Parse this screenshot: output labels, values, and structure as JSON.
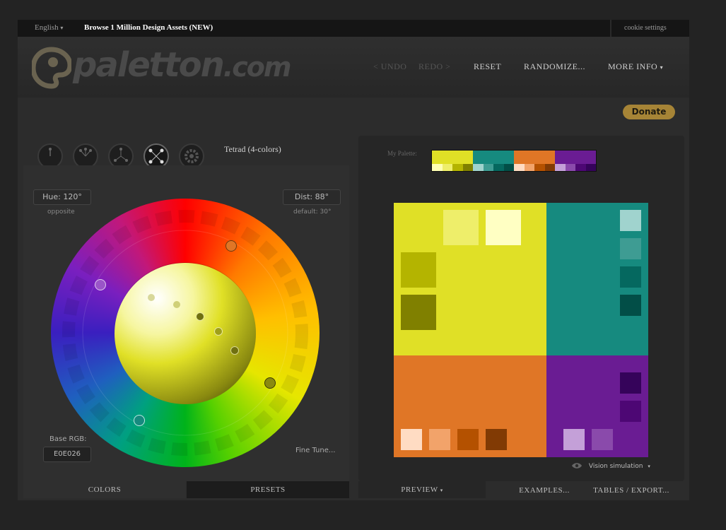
{
  "topbar": {
    "language": "English",
    "language_caret": "▾",
    "browse": "Browse 1 Million Design Assets (NEW)",
    "cookie": "cookie settings"
  },
  "header": {
    "logo_main": "paletton",
    "logo_tld": ".com",
    "undo": "< UNDO",
    "redo": "REDO >",
    "reset": "RESET",
    "randomize": "RANDOMIZE...",
    "more_info": "MORE INFO",
    "more_caret": "▾"
  },
  "donate": "Donate",
  "scheme": {
    "name": "Tetrad (4-colors)"
  },
  "controls": {
    "hue": "Hue: 120°",
    "hue_sub": "opposite",
    "dist": "Dist: 88°",
    "dist_sub": "default: 30°",
    "base_rgb_label": "Base RGB:",
    "base_rgb_value": "E0E026",
    "fine_tune": "Fine Tune..."
  },
  "left_tabs": {
    "colors": "COLORS",
    "presets": "PRESETS"
  },
  "palette": {
    "label": "My Palette:",
    "groups": [
      {
        "main": "#e0e026",
        "shades": [
          "#ffffb3",
          "#eeee6a",
          "#b4b400",
          "#808000"
        ]
      },
      {
        "main": "#168a7f",
        "shades": [
          "#a0d3ce",
          "#3e9c93",
          "#05685f",
          "#024e47"
        ]
      },
      {
        "main": "#e07626",
        "shades": [
          "#ffdcc3",
          "#f2a36a",
          "#b45100",
          "#813a04"
        ]
      },
      {
        "main": "#6a1c93",
        "shades": [
          "#c4a0d8",
          "#8a4aab",
          "#4d0774",
          "#35035a"
        ]
      }
    ]
  },
  "preview": {
    "yellow": {
      "main": "#e0e026",
      "s1": "#eeee6a",
      "s2": "#ffffc3",
      "s3": "#b4b400",
      "s4": "#808000"
    },
    "teal": {
      "main": "#168a7f",
      "s1": "#a0d3ce",
      "s2": "#3e9c93",
      "s3": "#05685f",
      "s4": "#024e47"
    },
    "orange": {
      "main": "#e07626",
      "s1": "#ffdcc3",
      "s2": "#f2a36a",
      "s3": "#b45100",
      "s4": "#813a04"
    },
    "purple": {
      "main": "#6a1c93",
      "s1": "#c4a0d8",
      "s2": "#8a4aab",
      "s3": "#4d0774",
      "s4": "#35035a"
    }
  },
  "vision": {
    "label": "Vision simulation",
    "caret": "▾"
  },
  "right_tabs": {
    "preview": "PREVIEW",
    "preview_caret": "▾",
    "examples": "EXAMPLES...",
    "tables": "TABLES / EXPORT..."
  }
}
